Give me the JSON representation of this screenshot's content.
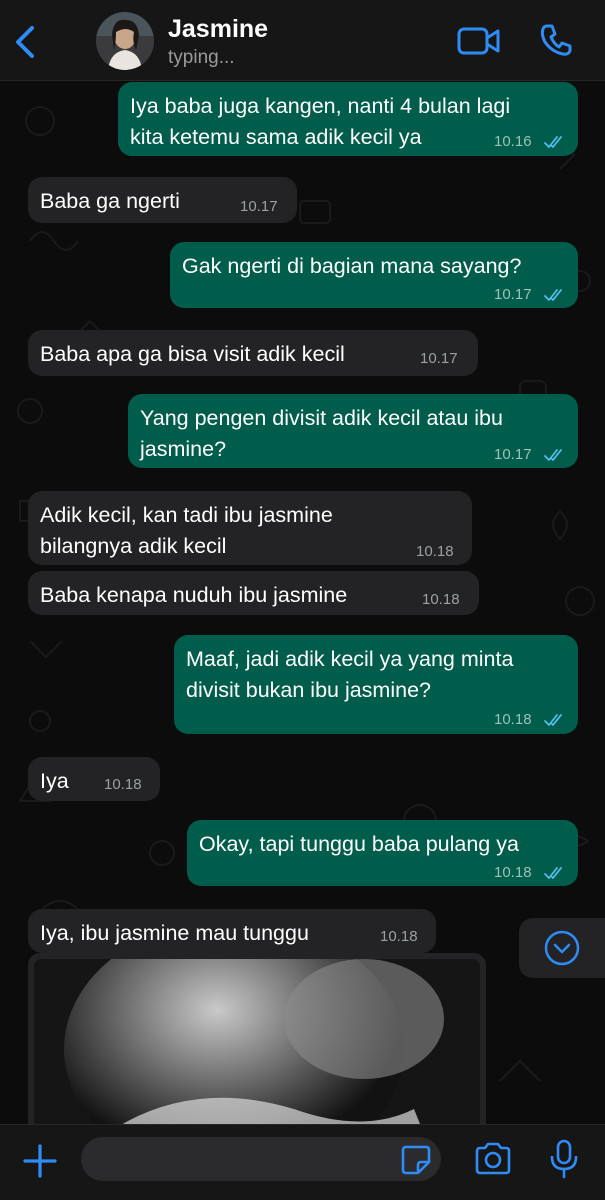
{
  "header": {
    "contact_name": "Jasmine",
    "status": "typing..."
  },
  "colors": {
    "accent": "#2f8cf5",
    "outgoing_bubble": "#005c4b",
    "incoming_bubble": "#232325",
    "read_ticks": "#53bdeb"
  },
  "messages": [
    {
      "direction": "out",
      "text": "Iya baba juga kangen, nanti 4 bulan lagi\nkita ketemu sama adik kecil ya",
      "time": "10.16",
      "read": true
    },
    {
      "direction": "in",
      "text": "Baba ga ngerti",
      "time": "10.17"
    },
    {
      "direction": "out",
      "text": "Gak ngerti di bagian mana sayang?",
      "time": "10.17",
      "read": true
    },
    {
      "direction": "in",
      "text": "Baba apa ga bisa visit adik kecil",
      "time": "10.17"
    },
    {
      "direction": "out",
      "text": "Yang pengen divisit adik kecil atau ibu\njasmine?",
      "time": "10.17",
      "read": true
    },
    {
      "direction": "in",
      "text": "Adik kecil, kan tadi ibu jasmine\nbilangnya adik kecil",
      "time": "10.18"
    },
    {
      "direction": "in",
      "text": "Baba kenapa nuduh ibu jasmine",
      "time": "10.18"
    },
    {
      "direction": "out",
      "text": "Maaf, jadi adik kecil ya yang minta\ndivisit bukan ibu jasmine?",
      "time": "10.18",
      "read": true
    },
    {
      "direction": "in",
      "text": "Iya",
      "time": "10.18"
    },
    {
      "direction": "out",
      "text": "Okay, tapi tunggu baba pulang ya",
      "time": "10.18",
      "read": true
    },
    {
      "direction": "in",
      "text": "Iya, ibu jasmine mau tunggu",
      "time": "10.18"
    }
  ],
  "media_message": {
    "type": "image",
    "icon": "ultrasound-photo"
  },
  "input_bar": {
    "placeholder": "",
    "icons": [
      "plus-icon",
      "sticker-icon",
      "camera-icon",
      "microphone-icon"
    ]
  }
}
